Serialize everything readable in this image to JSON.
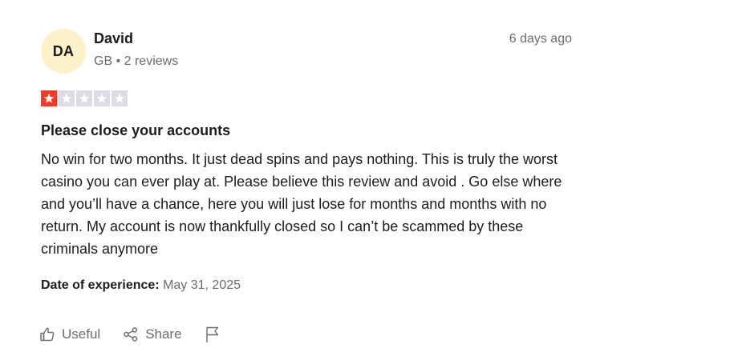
{
  "reviewer": {
    "initials": "DA",
    "name": "David",
    "country": "GB",
    "separator": " • ",
    "reviews_count": "2 reviews"
  },
  "posted": "6 days ago",
  "rating": {
    "value": 1,
    "max": 5,
    "filled_color": "#ff3722",
    "empty_color": "#dcdce6"
  },
  "review": {
    "title": "Please close your accounts",
    "body": "No win for two months. It just dead spins and pays nothing. This is truly the worst casino you can ever play at. Please believe this review and avoid . Go else where and you’ll have a chance, here you will just lose for months and months with no return. My account is now thankfully closed so I can’t be scammed by these criminals anymore"
  },
  "experience": {
    "label": "Date of experience:",
    "date": "May 31, 2025"
  },
  "actions": {
    "useful_label": "Useful",
    "share_label": "Share",
    "useful_icon": "thumbs-up-icon",
    "share_icon": "share-icon",
    "report_icon": "flag-icon"
  }
}
